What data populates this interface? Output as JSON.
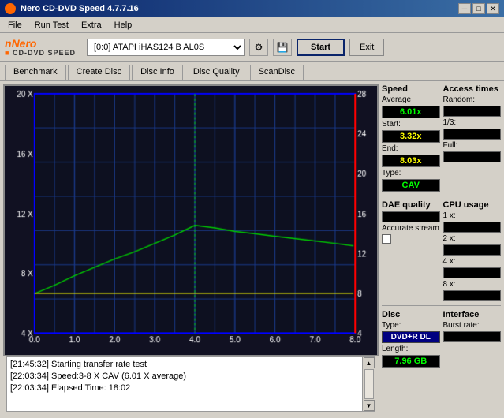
{
  "titleBar": {
    "title": "Nero CD-DVD Speed 4.7.7.16",
    "icon": "nero-icon",
    "controls": [
      "minimize",
      "maximize",
      "close"
    ]
  },
  "menu": {
    "items": [
      "File",
      "Run Test",
      "Extra",
      "Help"
    ]
  },
  "toolbar": {
    "logo": {
      "top": "Nero",
      "bottom": "CD-DVD SPEED"
    },
    "drive": "[0:0]  ATAPI iHAS124  B AL0S",
    "start_label": "Start",
    "exit_label": "Exit"
  },
  "tabs": [
    "Benchmark",
    "Create Disc",
    "Disc Info",
    "Disc Quality",
    "ScanDisc"
  ],
  "chart": {
    "leftAxis": {
      "max": 20,
      "labels": [
        "20 X",
        "16 X",
        "12 X",
        "8 X",
        "4 X"
      ]
    },
    "rightAxis": {
      "labels": [
        "28",
        "24",
        "20",
        "16",
        "12",
        "8",
        "4"
      ]
    },
    "bottomAxis": {
      "labels": [
        "0.0",
        "1.0",
        "2.0",
        "3.0",
        "4.0",
        "5.0",
        "6.0",
        "7.0",
        "8.0"
      ]
    }
  },
  "rightPanel": {
    "speed": {
      "title": "Speed",
      "average_label": "Average",
      "average_value": "6.01x",
      "start_label": "Start:",
      "start_value": "3.32x",
      "end_label": "End:",
      "end_value": "8.03x",
      "type_label": "Type:",
      "type_value": "CAV"
    },
    "accessTimes": {
      "title": "Access times",
      "random_label": "Random:",
      "random_value": "",
      "third_label": "1/3:",
      "third_value": "",
      "full_label": "Full:",
      "full_value": ""
    },
    "daeQuality": {
      "title": "DAE quality",
      "value": "",
      "accurate_stream_label": "Accurate stream"
    },
    "cpuUsage": {
      "title": "CPU usage",
      "x1_label": "1 x:",
      "x1_value": "",
      "x2_label": "2 x:",
      "x2_value": "",
      "x4_label": "4 x:",
      "x4_value": "",
      "x8_label": "8 x:",
      "x8_value": ""
    },
    "disc": {
      "title": "Disc",
      "type_label": "Type:",
      "type_value": "DVD+R DL",
      "length_label": "Length:",
      "length_value": "7.96 GB"
    },
    "interface": {
      "title": "Interface",
      "burst_label": "Burst rate:",
      "burst_value": ""
    }
  },
  "log": {
    "lines": [
      {
        "time": "[21:45:32]",
        "msg": "Starting transfer rate test"
      },
      {
        "time": "[22:03:34]",
        "msg": "Speed:3-8 X CAV (6.01 X average)"
      },
      {
        "time": "[22:03:34]",
        "msg": "Elapsed Time: 18:02"
      }
    ]
  }
}
